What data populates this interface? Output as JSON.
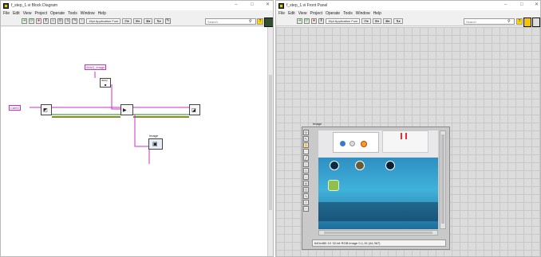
{
  "block_diagram": {
    "title": "f_step_1.vi Block Diagram",
    "menus": [
      "File",
      "Edit",
      "View",
      "Project",
      "Operate",
      "Tools",
      "Window",
      "Help"
    ],
    "font": "15pt Application Font",
    "search_placeholder": "Search",
    "help_glyph": "?",
    "win_controls": {
      "minimize": "–",
      "maximize": "□",
      "close": "✕"
    },
    "nodes": {
      "constant_label": "Cam0",
      "img_constant_label": "IMAQ_image",
      "indicator_label": "Image"
    }
  },
  "front_panel": {
    "title": "f_step_1.vi Front Panel",
    "menus": [
      "File",
      "Edit",
      "View",
      "Project",
      "Operate",
      "Tools",
      "Window",
      "Help"
    ],
    "font": "15pt Application Font",
    "search_placeholder": "Search",
    "help_glyph": "?",
    "win_controls": {
      "minimize": "–",
      "maximize": "□",
      "close": "✕"
    },
    "image_display": {
      "label": "Image",
      "status": "640x480 1X 32-bit RGB image 0,1,15    (44,367)"
    }
  },
  "colors": {
    "wire_pink": "#c830c8",
    "wire_olive": "#8a8a20",
    "wire_green": "#1e8a1e",
    "window_bg": "#f0f0f0"
  },
  "icons": [
    "labview-app-icon",
    "run-arrow-icon",
    "run-continuous-icon",
    "abort-icon",
    "pause-icon",
    "highlight-icon",
    "search-icon",
    "help-icon",
    "vi-connector-icon",
    "vi-icon"
  ]
}
